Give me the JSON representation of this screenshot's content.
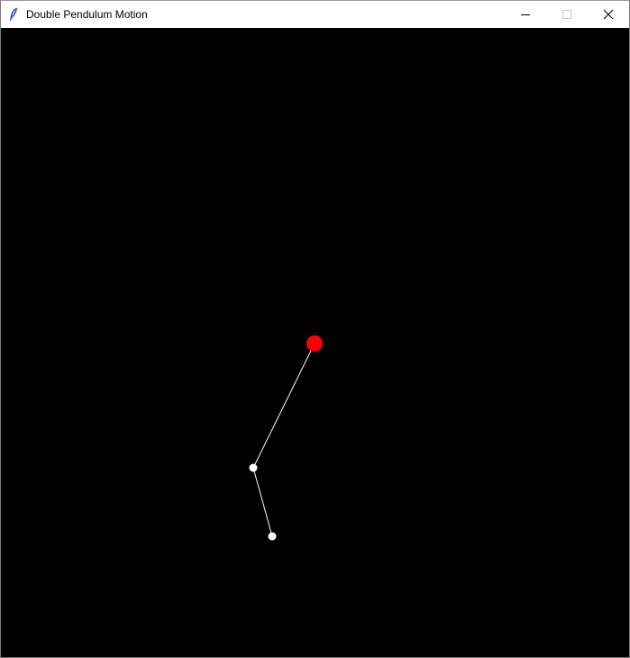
{
  "window": {
    "title": "Double Pendulum Motion"
  },
  "icons": {
    "app": "feather-icon",
    "minimize": "minimize-icon",
    "maximize": "maximize-icon",
    "close": "close-icon"
  },
  "colors": {
    "background": "#000000",
    "pivot": "#ff0000",
    "rod": "#ffffff",
    "bob": "#ffffff"
  }
}
